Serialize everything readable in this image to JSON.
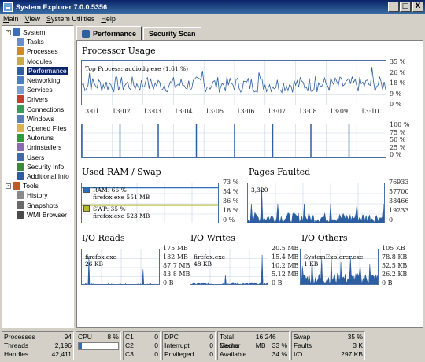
{
  "window": {
    "title": "System Explorer 7.0.0.5356",
    "min": "_",
    "max": "□",
    "close": "X"
  },
  "menu": [
    "Main",
    "View",
    "System Utilities",
    "Help"
  ],
  "tree": [
    {
      "label": "System",
      "color": "#3b6fb6",
      "indent": 0,
      "expand": "-"
    },
    {
      "label": "Tasks",
      "color": "#6b8fc7",
      "indent": 1
    },
    {
      "label": "Processes",
      "color": "#d08a2a",
      "indent": 1
    },
    {
      "label": "Modules",
      "color": "#c9a94a",
      "indent": 1
    },
    {
      "label": "Performance",
      "color": "#2c5ea0",
      "indent": 1,
      "selected": true
    },
    {
      "label": "Networking",
      "color": "#4c7fc0",
      "indent": 1
    },
    {
      "label": "Services",
      "color": "#7aa0d0",
      "indent": 1
    },
    {
      "label": "Drivers",
      "color": "#c04030",
      "indent": 1
    },
    {
      "label": "Connections",
      "color": "#3a9a5a",
      "indent": 1
    },
    {
      "label": "Windows",
      "color": "#5a7fb5",
      "indent": 1
    },
    {
      "label": "Opened Files",
      "color": "#d9b350",
      "indent": 1
    },
    {
      "label": "Autoruns",
      "color": "#2f9a3a",
      "indent": 1
    },
    {
      "label": "Uninstallers",
      "color": "#8a6ab0",
      "indent": 1
    },
    {
      "label": "Users",
      "color": "#3f6aa5",
      "indent": 1
    },
    {
      "label": "Security Info",
      "color": "#3a8a3a",
      "indent": 1
    },
    {
      "label": "Additional Info",
      "color": "#2c5ea0",
      "indent": 1
    },
    {
      "label": "Tools",
      "color": "#c05a20",
      "indent": 0,
      "expand": "-"
    },
    {
      "label": "History",
      "color": "#8a8a8a",
      "indent": 1
    },
    {
      "label": "Snapshots",
      "color": "#6a6a6a",
      "indent": 1
    },
    {
      "label": "WMI Browser",
      "color": "#4a4a4a",
      "indent": 1
    }
  ],
  "tabs": {
    "performance": "Performance",
    "security": "Security Scan"
  },
  "processor": {
    "heading": "Processor Usage",
    "top_process": "Top Process: audiodg.exe (1.61 %)",
    "yaxis": [
      "35 %",
      "26 %",
      "18 %",
      "9 %",
      "0 %"
    ],
    "times": [
      "13:01",
      "13:02",
      "13:03",
      "13:04",
      "13:05",
      "13:06",
      "13:07",
      "13:08",
      "13:09",
      "13:10"
    ],
    "yaxis2": [
      "100 %",
      "75 %",
      "50 %",
      "25 %",
      "0 %"
    ]
  },
  "ram": {
    "heading": "Used RAM / Swap",
    "ram_line": "RAM: 66 %",
    "ram_top": "firefox.exe 551 MB",
    "swp_line": "SWP: 35 %",
    "swp_top": "firefox.exe 523 MB",
    "ram_color": "#2c6fb6",
    "swp_color": "#b8b82a",
    "yaxis": [
      "73 %",
      "54 %",
      "36 %",
      "18 %",
      "0 %"
    ]
  },
  "pages": {
    "heading": "Pages Faulted",
    "peak": "3,320",
    "yaxis": [
      "76933",
      "57700",
      "38466",
      "19233",
      "0"
    ]
  },
  "io_reads": {
    "heading": "I/O Reads",
    "top": "firefox.exe",
    "val": "26 KB",
    "yaxis": [
      "175 MB",
      "132 MB",
      "87.7 MB",
      "43.8 MB",
      "0 B"
    ]
  },
  "io_writes": {
    "heading": "I/O Writes",
    "top": "firefox.exe",
    "val": "48 KB",
    "yaxis": [
      "20.5 MB",
      "15.4 MB",
      "10.2 MB",
      "5.12 MB",
      "0 B"
    ]
  },
  "io_others": {
    "heading": "I/O Others",
    "top": "SystemExplorer.exe",
    "val": "1 KB",
    "yaxis": [
      "105 KB",
      "78.8 KB",
      "52.5 KB",
      "26.2 KB",
      "0 B"
    ]
  },
  "status": {
    "processes_l": "Processes",
    "processes_v": "94",
    "threads_l": "Threads",
    "threads_v": "2,196",
    "handles_l": "Handles",
    "handles_v": "42,411",
    "cpu_l": "CPU",
    "cpu_v": "8 %",
    "cpu_frac": 0.08,
    "c1_l": "C1",
    "c1_v": "0",
    "c2_l": "C2",
    "c2_v": "0",
    "c3_l": "C3",
    "c3_v": "0",
    "dpc_l": "DPC",
    "dpc_v": "0",
    "int_l": "Interrupt",
    "int_v": "0",
    "priv_l": "Privileged",
    "priv_v": "0",
    "mem_l": "Total Memor",
    "mem_v": "16,246 MB",
    "cache_l": "Cache",
    "cache_v": "33 %",
    "avail_l": "Available",
    "avail_v": "34 %",
    "swap_l": "Swap",
    "swap_v": "35 %",
    "faults_l": "Faults",
    "faults_v": "3 K",
    "io_l": "I/O",
    "io_v": "297 KB"
  }
}
